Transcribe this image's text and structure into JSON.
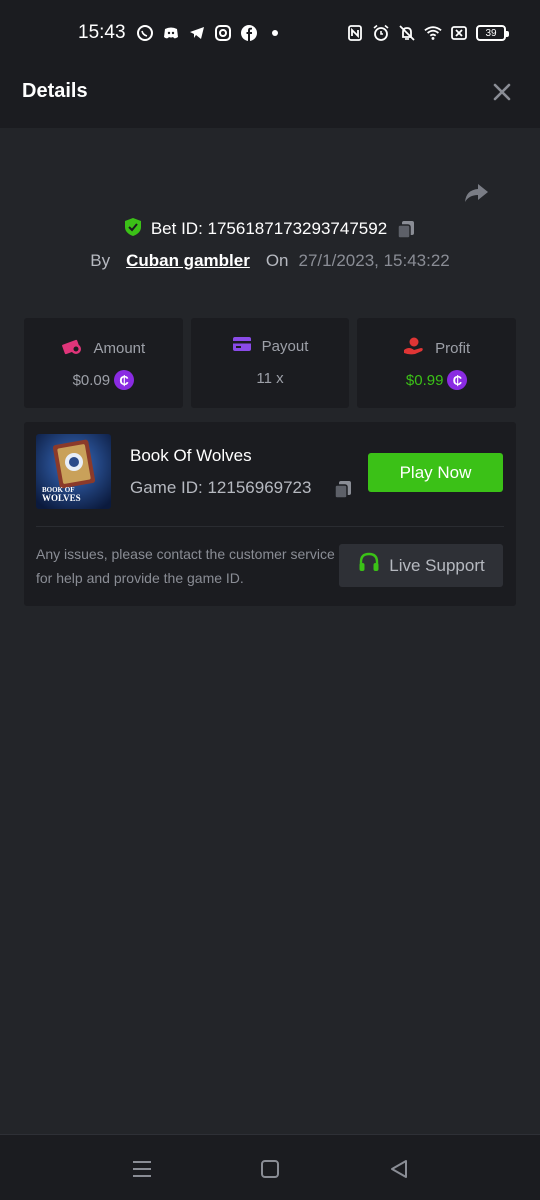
{
  "status_bar": {
    "time": "15:43",
    "left_icons": [
      "whatsapp-icon",
      "discord-icon",
      "telegram-icon",
      "instagram-icon",
      "facebook-icon",
      "dot-icon"
    ],
    "right_icons": [
      "nfc-icon",
      "alarm-icon",
      "bell-off-icon",
      "wifi-icon",
      "sim-x-icon"
    ],
    "battery": "39"
  },
  "header": {
    "title": "Details",
    "close_icon": "close-icon"
  },
  "bet": {
    "id_text": "Bet ID: 1756187173293747592",
    "by_label": "By",
    "user": "Cuban gambler",
    "on_label": "On",
    "date": "27/1/2023, 15:43:22"
  },
  "stats": [
    {
      "label": "Amount",
      "value": "$0.09",
      "icon": "money-icon",
      "coin": "₵"
    },
    {
      "label": "Payout",
      "value": "11 x",
      "icon": "card-icon"
    },
    {
      "label": "Profit",
      "value": "$0.99",
      "icon": "hand-coin-icon",
      "coin": "₵"
    }
  ],
  "game": {
    "name": "Book Of Wolves",
    "id_text": "Game ID: 12156969723",
    "play_label": "Play Now",
    "thumb_text": "BOOK OF WOLVES"
  },
  "support": {
    "text": "Any issues, please contact the customer service for help and provide the game ID.",
    "button_label": "Live Support"
  },
  "colors": {
    "accent_green": "#3bc117",
    "background": "#232529",
    "panel": "#1b1c20",
    "coin_purple": "#8a2be2"
  }
}
